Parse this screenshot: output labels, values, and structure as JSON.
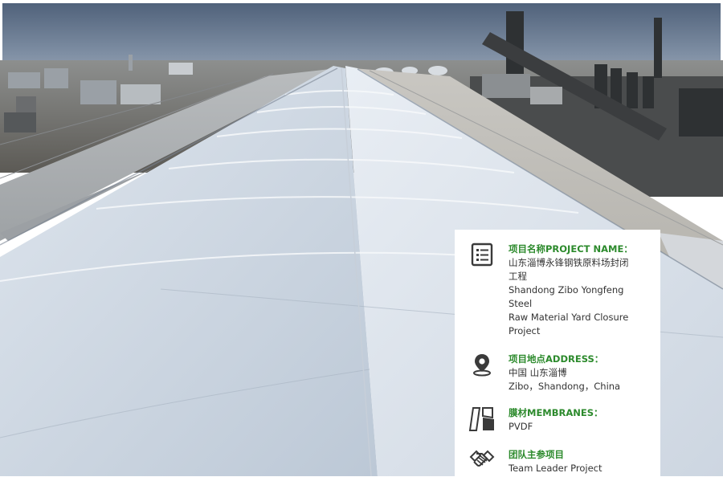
{
  "project": {
    "name_title": "项目名称PROJECT NAME：",
    "name_value": "山东淄博永锋钢铁原料场封闭\n工程\nShandong Zibo Yongfeng Steel\nRaw Material Yard Closure\nProject",
    "address_title": "项目地点ADDRESS：",
    "address_value": "中国 山东淄博\nZibo，Shandong，China",
    "membranes_title": "膜材MEMBRANES：",
    "membranes_value": "PVDF",
    "role_title": "团队主参项目",
    "role_value": "Team Leader Project"
  },
  "icons": {
    "name": "list-document-icon",
    "address": "location-pin-icon",
    "membranes": "membrane-panels-icon",
    "role": "handshake-icon"
  },
  "colors": {
    "accent_green": "#2c8a2c",
    "text_dark": "#333333",
    "icon_dark": "#3a3a3a",
    "card_bg": "#ffffff"
  }
}
